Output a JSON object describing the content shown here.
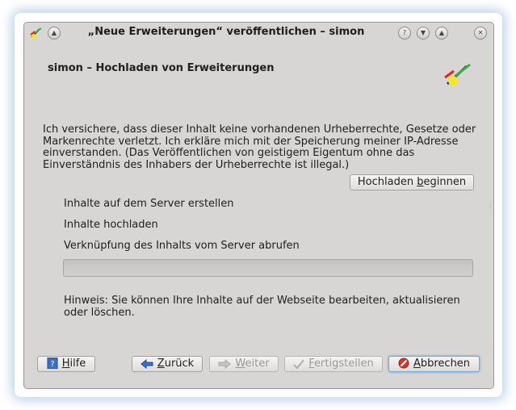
{
  "window": {
    "title": "„Neue Erweiterungen“ veröffentlichen – simon"
  },
  "header": {
    "title": "simon – Hochladen von Erweiterungen"
  },
  "disclaimer": "Ich versichere, dass dieser Inhalt keine vorhandenen Urheberrechte, Gesetze oder Markenrechte verletzt. Ich erkläre mich mit der Speicherung meiner IP-Adresse einverstanden. (Das Veröffentlichen von geistigem Eigentum ohne das Einverständnis des Inhabers der Urheberrechte ist illegal.)",
  "upload_button": {
    "pre": "Hochladen ",
    "accel": "b",
    "post": "eginnen"
  },
  "steps": [
    "Inhalte auf dem Server erstellen",
    "Inhalte hochladen",
    "Verknüpfung des Inhalts vom Server abrufen"
  ],
  "progress": {
    "value": 0
  },
  "hint": "Hinweis: Sie können Ihre Inhalte auf der Webseite bearbeiten, aktualisieren oder löschen.",
  "buttons": {
    "help": {
      "accel": "H",
      "rest": "ilfe"
    },
    "back": {
      "accel": "Z",
      "rest": "urück"
    },
    "next": {
      "accel": "W",
      "rest": "eiter"
    },
    "finish": {
      "accel": "F",
      "rest": "ertigstellen"
    },
    "cancel": {
      "accel": "A",
      "rest": "bbrechen"
    }
  },
  "colors": {
    "logo_red": "#e8211c",
    "logo_green": "#32b23a",
    "logo_blue": "#1a2a8c",
    "logo_yellow": "#f5e81c",
    "cancel_icon": "#d9332a",
    "help_icon": "#3b6fc4"
  }
}
